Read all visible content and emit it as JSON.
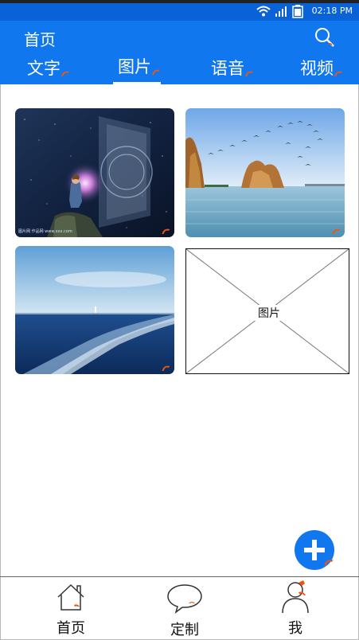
{
  "status_bar": {
    "time": "02:18 PM"
  },
  "header": {
    "title": "首页"
  },
  "tabs": [
    {
      "label": "文字"
    },
    {
      "label": "图片"
    },
    {
      "label": "语音"
    },
    {
      "label": "视频"
    }
  ],
  "active_tab": "图片",
  "gallery": {
    "placeholder_label": "图片"
  },
  "bottom_nav": [
    {
      "label": "首页",
      "icon": "home-icon"
    },
    {
      "label": "定制",
      "icon": "chat-bubble-icon"
    },
    {
      "label": "我",
      "icon": "user-icon"
    }
  ],
  "colors": {
    "brand": "#1177ee",
    "status_bar": "#0a62d8",
    "annotation": "#ee5511"
  }
}
